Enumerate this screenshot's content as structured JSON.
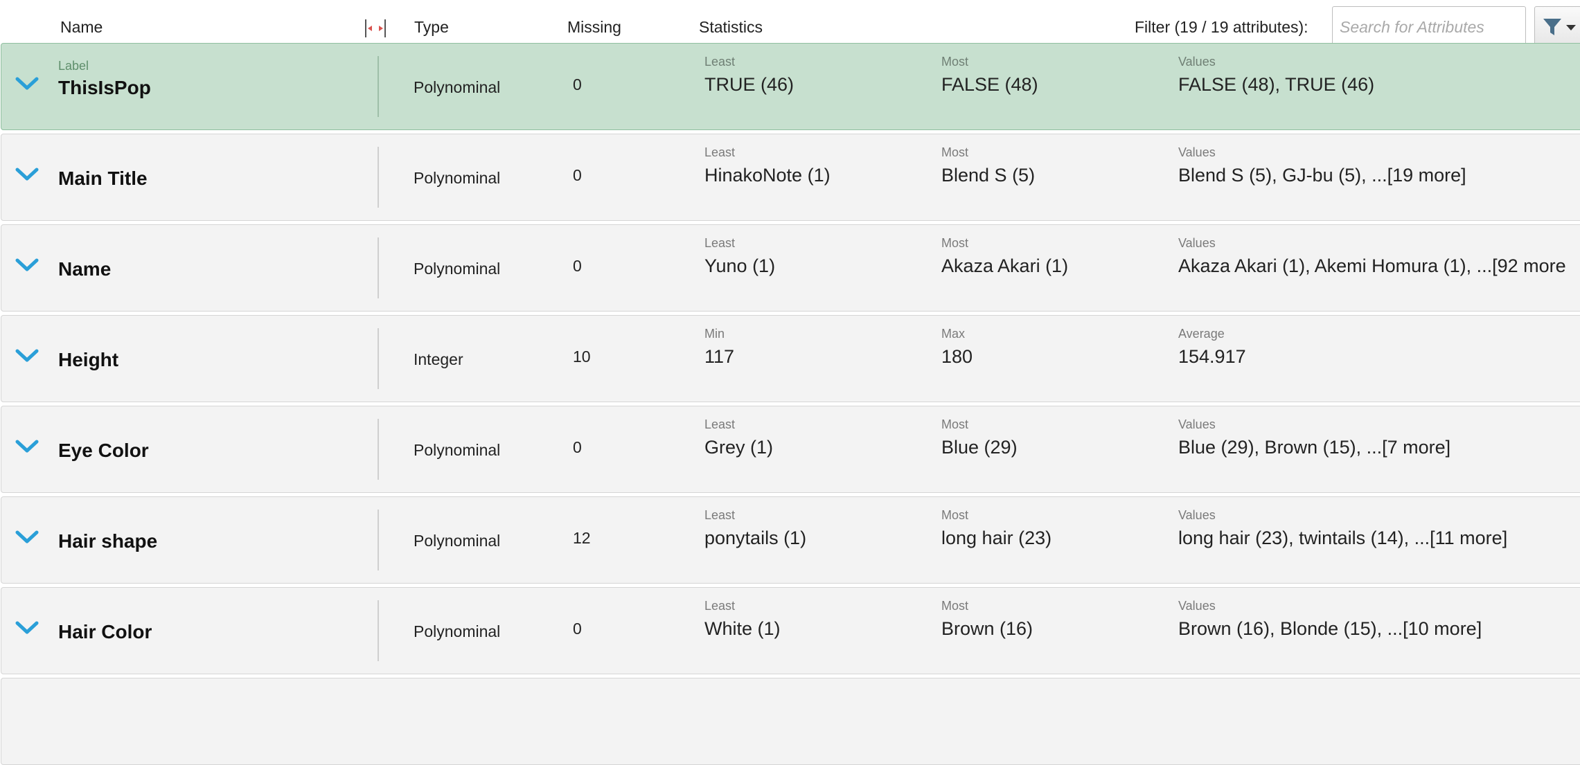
{
  "header": {
    "col_name": "Name",
    "col_type": "Type",
    "col_missing": "Missing",
    "col_statistics": "Statistics",
    "filter_label": "Filter (19 / 19 attributes):",
    "search_placeholder": "Search for Attributes",
    "icons": {
      "resize": "column-resize-icon",
      "filter": "filter-icon",
      "dropdown": "chevron-down-icon"
    }
  },
  "colors": {
    "selected_row_bg": "#c7e0cf",
    "row_bg": "#f3f3f3",
    "chevron": "#2a9fd8"
  },
  "rows": [
    {
      "role": "Label",
      "name": "ThisIsPop",
      "type": "Polynominal",
      "missing": "0",
      "stat1_cap": "Least",
      "stat1_val": "TRUE (46)",
      "stat2_cap": "Most",
      "stat2_val": "FALSE (48)",
      "stat3_cap": "Values",
      "stat3_val": "FALSE (48), TRUE (46)",
      "selected": true
    },
    {
      "role": "",
      "name": "Main Title",
      "type": "Polynominal",
      "missing": "0",
      "stat1_cap": "Least",
      "stat1_val": "HinakoNote (1)",
      "stat2_cap": "Most",
      "stat2_val": "Blend S (5)",
      "stat3_cap": "Values",
      "stat3_val": "Blend S (5), GJ-bu (5), ...[19 more]"
    },
    {
      "role": "",
      "name": "Name",
      "type": "Polynominal",
      "missing": "0",
      "stat1_cap": "Least",
      "stat1_val": "Yuno (1)",
      "stat2_cap": "Most",
      "stat2_val": "Akaza Akari (1)",
      "stat3_cap": "Values",
      "stat3_val": "Akaza Akari (1), Akemi Homura (1), ...[92 more"
    },
    {
      "role": "",
      "name": "Height",
      "type": "Integer",
      "missing": "10",
      "stat1_cap": "Min",
      "stat1_val": "117",
      "stat2_cap": "Max",
      "stat2_val": "180",
      "stat3_cap": "Average",
      "stat3_val": "154.917"
    },
    {
      "role": "",
      "name": "Eye Color",
      "type": "Polynominal",
      "missing": "0",
      "stat1_cap": "Least",
      "stat1_val": "Grey (1)",
      "stat2_cap": "Most",
      "stat2_val": "Blue (29)",
      "stat3_cap": "Values",
      "stat3_val": "Blue (29), Brown (15), ...[7 more]"
    },
    {
      "role": "",
      "name": "Hair shape",
      "type": "Polynominal",
      "missing": "12",
      "stat1_cap": "Least",
      "stat1_val": "ponytails (1)",
      "stat2_cap": "Most",
      "stat2_val": "long hair (23)",
      "stat3_cap": "Values",
      "stat3_val": "long hair (23), twintails (14), ...[11 more]"
    },
    {
      "role": "",
      "name": "Hair Color",
      "type": "Polynominal",
      "missing": "0",
      "stat1_cap": "Least",
      "stat1_val": "White (1)",
      "stat2_cap": "Most",
      "stat2_val": "Brown (16)",
      "stat3_cap": "Values",
      "stat3_val": "Brown (16), Blonde (15), ...[10 more]"
    }
  ]
}
